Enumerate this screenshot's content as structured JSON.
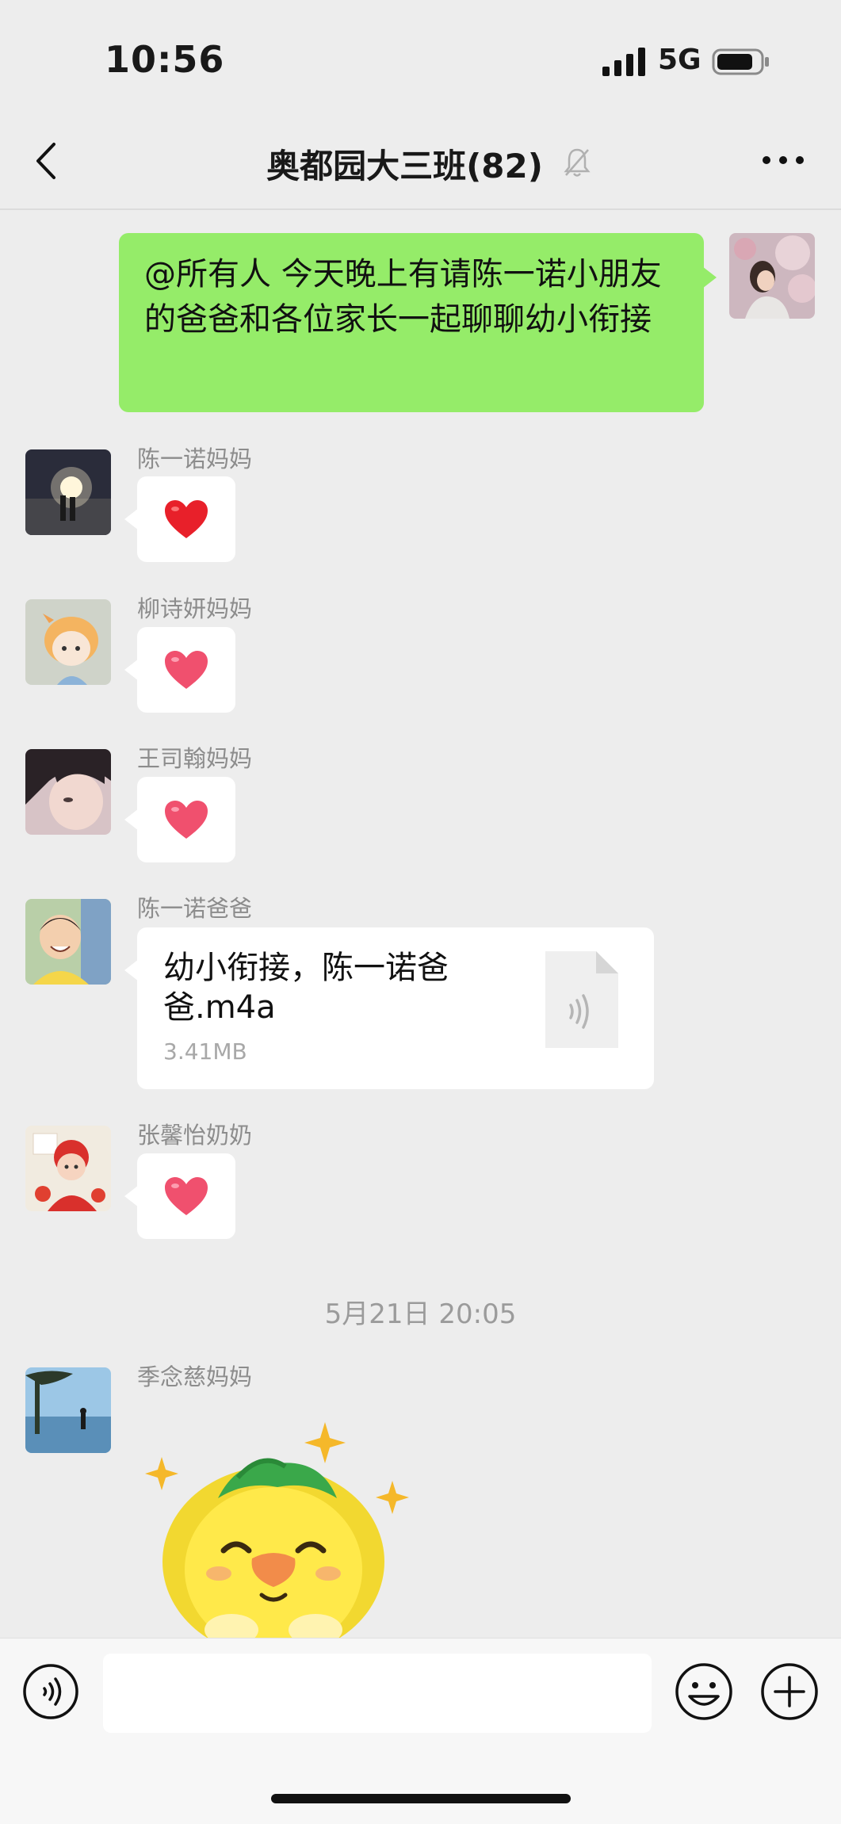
{
  "status_bar": {
    "time": "10:56",
    "network": "5G"
  },
  "nav": {
    "title": "奥都园大三班(82)"
  },
  "messages": [
    {
      "type": "text",
      "direction": "out",
      "text": "@所有人 今天晚上有请陈一诺小朋友的爸爸和各位家长一起聊聊幼小衔接"
    },
    {
      "type": "emoji",
      "sender": "陈一诺妈妈",
      "emoji": "red-heart"
    },
    {
      "type": "emoji",
      "sender": "柳诗妍妈妈",
      "emoji": "pink-heart"
    },
    {
      "type": "emoji",
      "sender": "王司翰妈妈",
      "emoji": "pink-heart"
    },
    {
      "type": "file",
      "sender": "陈一诺爸爸",
      "file_name": "幼小衔接，陈一诺爸爸.m4a",
      "file_size": "3.41MB"
    },
    {
      "type": "emoji",
      "sender": "张馨怡奶奶",
      "emoji": "pink-heart"
    },
    {
      "type": "timestamp",
      "text": "5月21日 20:05"
    },
    {
      "type": "sticker",
      "sender": "季念慈妈妈",
      "sticker": "yellow-lion-sticker"
    }
  ],
  "colors": {
    "outgoing_bubble": "#95ec69",
    "background": "#ededed",
    "red_heart": "#e8202a",
    "pink_heart": "#f0506e"
  },
  "icons": [
    "back-arrow-icon",
    "mute-bell-icon",
    "more-dots-icon",
    "voice-icon",
    "emoji-face-icon",
    "plus-icon",
    "audio-file-icon"
  ],
  "input": {
    "value": "",
    "placeholder": ""
  }
}
